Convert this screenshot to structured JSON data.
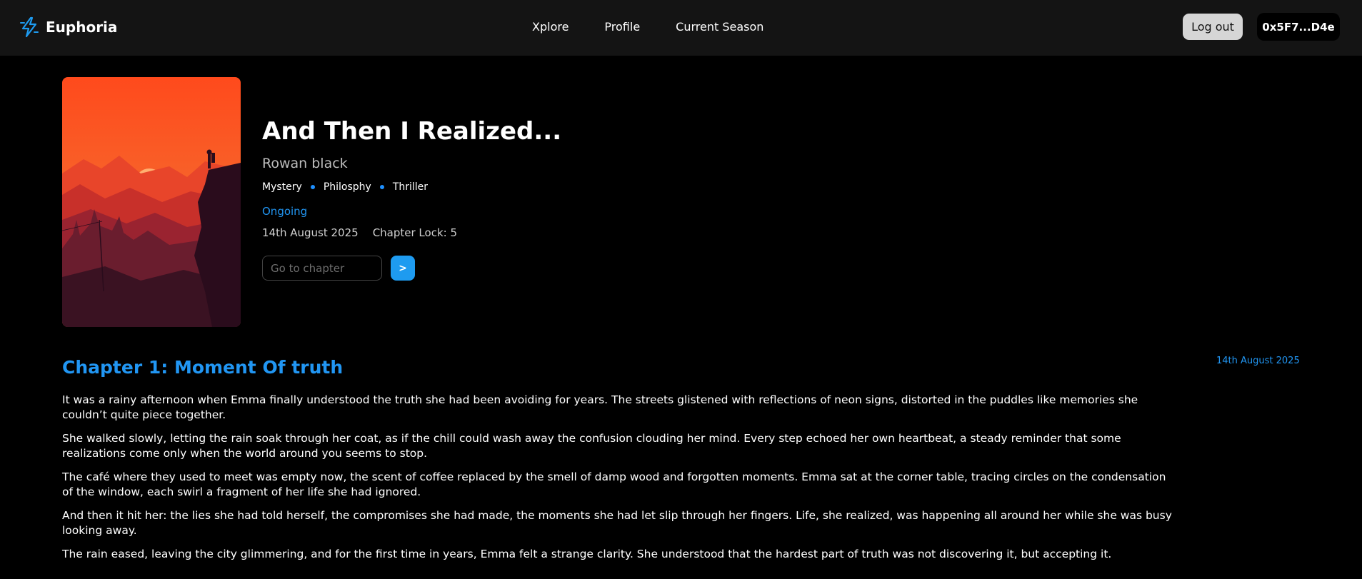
{
  "header": {
    "brand": "Euphoria",
    "nav": [
      "Xplore",
      "Profile",
      "Current Season"
    ],
    "logout_label": "Log out",
    "wallet": "0x5F7...D4e"
  },
  "book": {
    "title": "And Then I Realized...",
    "author": "Rowan black",
    "genres": [
      "Mystery",
      "Philosphy",
      "Thriller"
    ],
    "status": "Ongoing",
    "date": "14th August 2025",
    "chapter_lock": "Chapter Lock: 5",
    "chapter_input_placeholder": "Go to chapter",
    "go_label": ">"
  },
  "chapter": {
    "title": "Chapter 1: Moment Of truth",
    "date": "14th August 2025",
    "paragraphs": [
      "It was a rainy afternoon when Emma finally understood the truth she had been avoiding for years. The streets glistened with reflections of neon signs, distorted in the puddles like memories she couldn’t quite piece together.",
      "She walked slowly, letting the rain soak through her coat, as if the chill could wash away the confusion clouding her mind. Every step echoed her own heartbeat, a steady reminder that some realizations come only when the world around you seems to stop.",
      "The café where they used to meet was empty now, the scent of coffee replaced by the smell of damp wood and forgotten moments. Emma sat at the corner table, tracing circles on the condensation of the window, each swirl a fragment of her life she had ignored.",
      "And then it hit her: the lies she had told herself, the compromises she had made, the moments she had let slip through her fingers. Life, she realized, was happening all around her while she was busy looking away.",
      "The rain eased, leaving the city glimmering, and for the first time in years, Emma felt a strange clarity. She understood that the hardest part of truth was not discovering it, but accepting it."
    ]
  },
  "colors": {
    "accent": "#1e9bf0",
    "link_blue": "#2196f3",
    "header_bg": "#141414",
    "page_bg": "#000000"
  },
  "icons": {
    "brand": "lightning-bolt-icon"
  }
}
